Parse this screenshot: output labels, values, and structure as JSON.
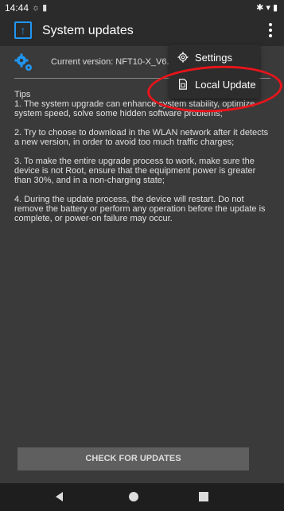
{
  "status_bar": {
    "time": "14:44",
    "left_icons": "☼ ▮",
    "right_icons": "✱ ▾ ▮"
  },
  "app_bar": {
    "icon_glyph": "↑",
    "title": "System updates"
  },
  "version": {
    "text": "Current version: NFT10-X_V6.00"
  },
  "tips": {
    "heading": "Tips",
    "items": [
      "1. The system upgrade can enhance system stability, optimize system speed, solve some hidden software problems;",
      "2. Try to choose to download in the WLAN network after it detects a new version, in order to avoid too much traffic charges;",
      "3. To make the entire upgrade process to work, make sure the device is not Root, ensure that the equipment power is greater than 30%, and in a non-charging state;",
      "4. During the update process, the device will restart. Do not remove the battery or perform any operation before the update is complete, or power-on failure may occur."
    ]
  },
  "check_button": {
    "label": "CHECK FOR UPDATES"
  },
  "menu": {
    "items": [
      {
        "label": "Settings",
        "icon": "gear-icon"
      },
      {
        "label": "Local Update",
        "icon": "file-icon"
      }
    ]
  },
  "colors": {
    "accent": "#2196f3",
    "annotation": "#e8141b"
  }
}
